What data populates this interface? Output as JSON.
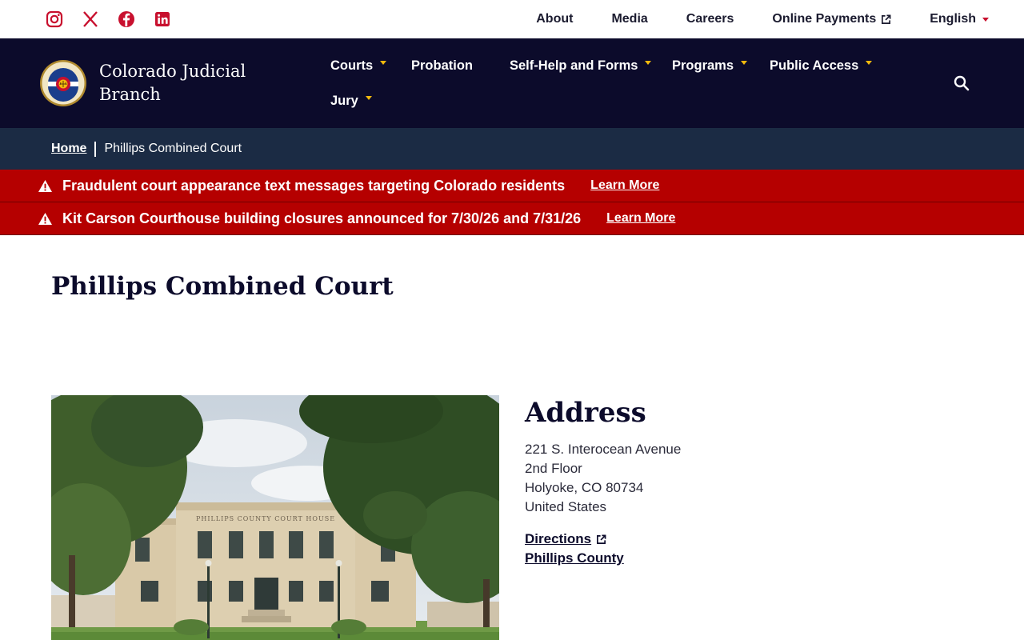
{
  "utility": {
    "social": [
      {
        "icon": "instagram-icon"
      },
      {
        "icon": "x-icon"
      },
      {
        "icon": "facebook-icon"
      },
      {
        "icon": "linkedin-icon"
      }
    ],
    "links": {
      "about": "About",
      "media": "Media",
      "careers": "Careers",
      "online_payments": "Online Payments",
      "language": "English"
    }
  },
  "header": {
    "brand": "Colorado Judicial Branch",
    "nav": {
      "courts": "Courts",
      "probation": "Probation",
      "self_help": "Self-Help and Forms",
      "programs": "Programs",
      "public_access": "Public Access",
      "jury": "Jury"
    }
  },
  "breadcrumb": {
    "home": "Home",
    "current": "Phillips Combined Court"
  },
  "alerts": [
    {
      "message": "Fraudulent court appearance text messages targeting Colorado residents",
      "link": "Learn More"
    },
    {
      "message": "Kit Carson Courthouse building closures announced for 7/30/26 and 7/31/26",
      "link": "Learn More"
    }
  ],
  "main": {
    "title": "Phillips Combined Court",
    "photo_sign": "PHILLIPS COUNTY COURT HOUSE",
    "address_heading": "Address",
    "address_lines": [
      "221 S. Interocean Avenue",
      "2nd Floor",
      "Holyoke, CO 80734",
      "United States"
    ],
    "directions": "Directions",
    "county": "Phillips County"
  },
  "colors": {
    "header_bg": "#0c0b2b",
    "breadcrumb_bg": "#1b2b44",
    "alert_bg": "#b50000",
    "accent_red": "#c8102e",
    "caret_gold": "#f2b90d"
  }
}
